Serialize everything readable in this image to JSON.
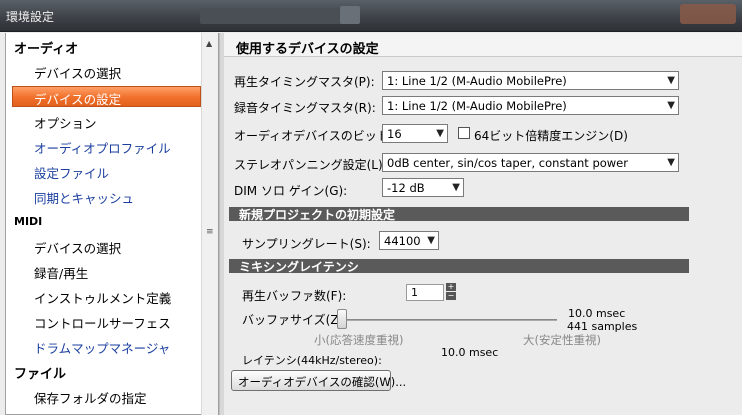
{
  "window": {
    "title": "環境設定"
  },
  "sidebar": {
    "sections": [
      {
        "label": "オーディオ"
      },
      {
        "label": "MIDI"
      },
      {
        "label": "ファイル"
      }
    ],
    "items": [
      {
        "label": "デバイスの選択"
      },
      {
        "label": "デバイスの設定"
      },
      {
        "label": "オプション"
      },
      {
        "label": "オーディオプロファイル"
      },
      {
        "label": "設定ファイル"
      },
      {
        "label": "同期とキャッシュ"
      },
      {
        "label": "デバイスの選択"
      },
      {
        "label": "録音/再生"
      },
      {
        "label": "インストゥルメント定義"
      },
      {
        "label": "コントロールサーフェス"
      },
      {
        "label": "ドラムマップマネージャ"
      },
      {
        "label": "保存フォルダの指定"
      }
    ],
    "selected": "デバイスの設定"
  },
  "main": {
    "header": "使用するデバイスの設定",
    "playback_master": {
      "label": "再生タイミングマスタ(P):",
      "value": "1: Line 1/2 (M-Audio MobilePre)"
    },
    "record_master": {
      "label": "録音タイミングマスタ(R):",
      "value": "1: Line 1/2 (M-Audio MobilePre)"
    },
    "bit_depth": {
      "label": "オーディオデバイスのビット数(T):",
      "value": "16"
    },
    "engine64": {
      "label": "64ビット倍精度エンジン(D)",
      "checked": false
    },
    "stereo_pan": {
      "label": "ステレオパンニング設定(L):",
      "value": "0dB center, sin/cos taper, constant power"
    },
    "dim_solo": {
      "label": "DIM ソロ ゲイン(G):",
      "value": "-12 dB"
    },
    "new_project_section": "新規プロジェクトの初期設定",
    "sampling_rate": {
      "label": "サンプリングレート(S):",
      "value": "44100"
    },
    "mixing_section": "ミキシングレイテンシ",
    "buffer_count": {
      "label": "再生バッファ数(F):",
      "value": "1"
    },
    "buffer_size": {
      "label": "バッファサイズ(Z):",
      "msec": "10.0 msec",
      "samples": "441 samples",
      "min_label": "小(応答速度重視)",
      "max_label": "大(安定性重視)",
      "level": 0.0
    },
    "latency": {
      "label": "レイテンシ(44kHz/stereo):",
      "value": "10.0 msec"
    },
    "check_button": "オーディオデバイスの確認(W)..."
  },
  "colors": {
    "selection": "#f0702c",
    "section_bar": "#5a5a5a",
    "link_blue": "#1a3e9e"
  }
}
